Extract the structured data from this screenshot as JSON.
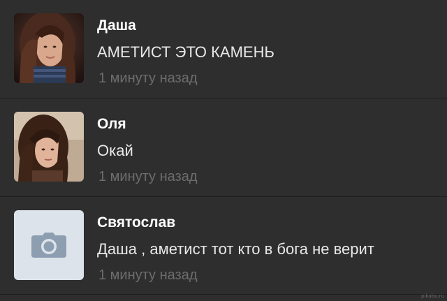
{
  "comments": [
    {
      "author": "Даша",
      "text": "АМЕТИСТ ЭТО КАМЕНЬ",
      "time": "1 минуту назад",
      "avatar": "photo"
    },
    {
      "author": "Оля",
      "text": "Окай",
      "time": "1 минуту назад",
      "avatar": "photo"
    },
    {
      "author": "Святослав",
      "text": "Даша , аметист тот кто в бога не верит",
      "time": "1 минуту назад",
      "avatar": "camera-icon"
    }
  ],
  "watermark": "pikabu.ru",
  "colors": {
    "background": "#2e2e2e",
    "divider": "#1e1e1e",
    "author": "#ffffff",
    "text": "#e8e8e8",
    "time": "#6d6d6d",
    "placeholder_avatar": "#dde3ea",
    "placeholder_icon": "#8e9eb1"
  }
}
